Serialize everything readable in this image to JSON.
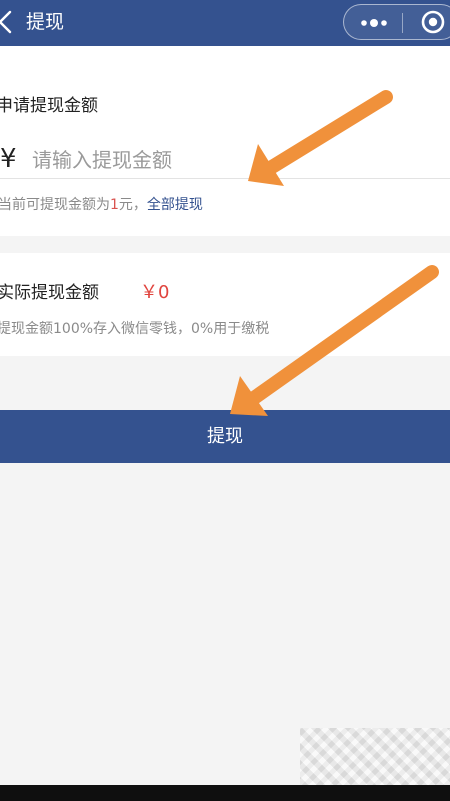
{
  "header": {
    "title": "提现",
    "back_icon": "chevron-left-icon",
    "more_icon": "more-dots-icon",
    "close_icon": "mini-program-close-icon"
  },
  "apply": {
    "label": "申请提现金额",
    "currency_symbol": "¥",
    "amount_placeholder": "请输入提现金额",
    "hint_prefix": "当前可提现金额为",
    "hint_amount": "1",
    "hint_suffix": "元，",
    "withdraw_all_label": "全部提现"
  },
  "actual": {
    "label": "实际提现金额",
    "value": "￥0",
    "note": "提现金额100%存入微信零钱，0%用于缴税"
  },
  "submit": {
    "label": "提现"
  },
  "colors": {
    "brand": "#34528f",
    "amount_red": "#e0443e",
    "annotation_arrow": "#f0913b"
  }
}
